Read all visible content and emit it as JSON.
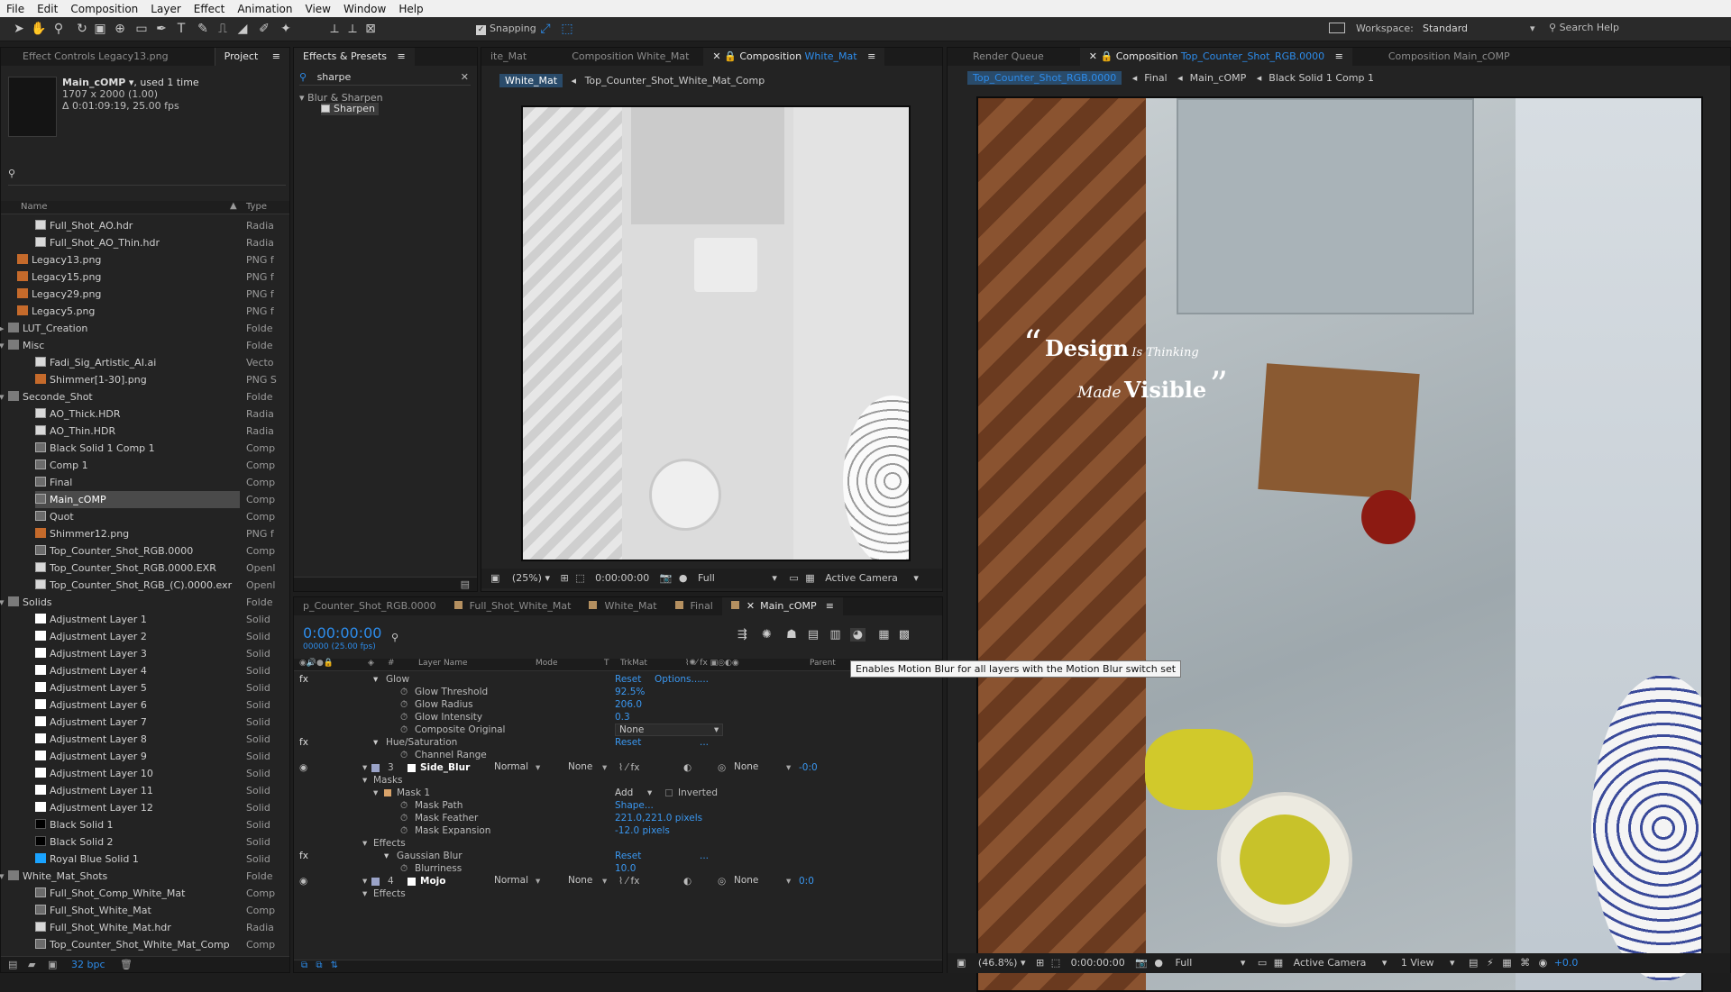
{
  "menu": [
    "File",
    "Edit",
    "Composition",
    "Layer",
    "Effect",
    "Animation",
    "View",
    "Window",
    "Help"
  ],
  "toolbar": {
    "snapping": "Snapping",
    "workspace_label": "Workspace:",
    "workspace_value": "Standard",
    "search_help": "Search Help"
  },
  "left_tabs": {
    "effect_controls": "Effect Controls Legacy13.png",
    "project": "Project"
  },
  "project_info": {
    "name": "Main_cOMP",
    "used": ", used 1 time",
    "size": "1707 x 2000 (1.00)",
    "duration": "Δ 0:01:09:19, 25.00 fps"
  },
  "project_cols": {
    "name": "Name",
    "type": "Type"
  },
  "project_items": [
    {
      "label": "Full_Shot_AO.hdr",
      "type": "Radia"
    },
    {
      "label": "Full_Shot_AO_Thin.hdr",
      "type": "Radia"
    },
    {
      "label": "Legacy13.png",
      "type": "PNG f"
    },
    {
      "label": "Legacy15.png",
      "type": "PNG f"
    },
    {
      "label": "Legacy29.png",
      "type": "PNG f"
    },
    {
      "label": "Legacy5.png",
      "type": "PNG f"
    },
    {
      "label": "LUT_Creation",
      "type": "Folde"
    },
    {
      "label": "Misc",
      "type": "Folde"
    },
    {
      "label": "Fadi_Sig_Artistic_AI.ai",
      "type": "Vecto"
    },
    {
      "label": "Shimmer[1-30].png",
      "type": "PNG S"
    },
    {
      "label": "Seconde_Shot",
      "type": "Folde"
    },
    {
      "label": "AO_Thick.HDR",
      "type": "Radia"
    },
    {
      "label": "AO_Thin.HDR",
      "type": "Radia"
    },
    {
      "label": "Black Solid 1 Comp 1",
      "type": "Comp"
    },
    {
      "label": "Comp 1",
      "type": "Comp"
    },
    {
      "label": "Final",
      "type": "Comp"
    },
    {
      "label": "Main_cOMP",
      "type": "Comp"
    },
    {
      "label": "Quot",
      "type": "Comp"
    },
    {
      "label": "Shimmer12.png",
      "type": "PNG f"
    },
    {
      "label": "Top_Counter_Shot_RGB.0000",
      "type": "Comp"
    },
    {
      "label": "Top_Counter_Shot_RGB.0000.EXR",
      "type": "Openl"
    },
    {
      "label": "Top_Counter_Shot_RGB_(C).0000.exr",
      "type": "Openl"
    },
    {
      "label": "Solids",
      "type": "Folde"
    },
    {
      "label": "Adjustment Layer 1",
      "type": "Solid"
    },
    {
      "label": "Adjustment Layer 2",
      "type": "Solid"
    },
    {
      "label": "Adjustment Layer 3",
      "type": "Solid"
    },
    {
      "label": "Adjustment Layer 4",
      "type": "Solid"
    },
    {
      "label": "Adjustment Layer 5",
      "type": "Solid"
    },
    {
      "label": "Adjustment Layer 6",
      "type": "Solid"
    },
    {
      "label": "Adjustment Layer 7",
      "type": "Solid"
    },
    {
      "label": "Adjustment Layer 8",
      "type": "Solid"
    },
    {
      "label": "Adjustment Layer 9",
      "type": "Solid"
    },
    {
      "label": "Adjustment Layer 10",
      "type": "Solid"
    },
    {
      "label": "Adjustment Layer 11",
      "type": "Solid"
    },
    {
      "label": "Adjustment Layer 12",
      "type": "Solid"
    },
    {
      "label": "Black Solid 1",
      "type": "Solid"
    },
    {
      "label": "Black Solid 2",
      "type": "Solid"
    },
    {
      "label": "Royal Blue Solid 1",
      "type": "Solid"
    },
    {
      "label": "White_Mat_Shots",
      "type": "Folde"
    },
    {
      "label": "Full_Shot_Comp_White_Mat",
      "type": "Comp"
    },
    {
      "label": "Full_Shot_White_Mat",
      "type": "Comp"
    },
    {
      "label": "Full_Shot_White_Mat.hdr",
      "type": "Radia"
    },
    {
      "label": "Top_Counter_Shot_White_Mat_Comp",
      "type": "Comp"
    }
  ],
  "project_footer": {
    "bpc": "32 bpc"
  },
  "effects": {
    "tab": "Effects & Presets",
    "search": "sharpe",
    "category": "Blur & Sharpen",
    "item": "Sharpen"
  },
  "mid_viewer": {
    "tabs": [
      "ite_Mat",
      "Composition White_Mat",
      "Composition"
    ],
    "active_comp": "White_Mat",
    "crumb1": "White_Mat",
    "crumb2": "Top_Counter_Shot_White_Mat_Comp",
    "zoom": "(25%)",
    "time": "0:00:00:00",
    "res": "Full",
    "camera": "Active Camera"
  },
  "right_viewer": {
    "tabs": [
      "Render Queue",
      "Composition",
      "Composition Main_cOMP"
    ],
    "active_comp": "Top_Counter_Shot_RGB.0000",
    "crumbs": [
      "Top_Counter_Shot_RGB.0000",
      "Final",
      "Main_cOMP",
      "Black Solid 1 Comp 1"
    ],
    "quote_design": "Design",
    "quote_is": "Is Thinking",
    "quote_made": "Made",
    "quote_visible": "Visible",
    "zoom": "(46.8%)",
    "time": "0:00:00:00",
    "res": "Full",
    "camera": "Active Camera",
    "views": "1 View",
    "exposure": "+0.0"
  },
  "timeline": {
    "tabs": [
      "p_Counter_Shot_RGB.0000",
      "Full_Shot_White_Mat",
      "White_Mat",
      "Final",
      "Main_cOMP"
    ],
    "timecode": "0:00:00:00",
    "fps": "00000 (25.00 fps)",
    "cols": {
      "num": "#",
      "layer": "Layer Name",
      "mode": "Mode",
      "t": "T",
      "trkmat": "TrkMat",
      "parent": "Parent"
    },
    "tooltip": "Enables Motion Blur for all layers with the Motion Blur switch set",
    "rows": [
      {
        "kind": "fx",
        "label": "Glow",
        "v1": "Reset",
        "v2": "Options...",
        "v3": "..."
      },
      {
        "kind": "prop",
        "label": "Glow Threshold",
        "val": "92.5%"
      },
      {
        "kind": "prop",
        "label": "Glow Radius",
        "val": "206.0"
      },
      {
        "kind": "prop",
        "label": "Glow Intensity",
        "val": "0.3"
      },
      {
        "kind": "propdd",
        "label": "Composite Original",
        "val": "None"
      },
      {
        "kind": "fx",
        "label": "Hue/Saturation",
        "v1": "Reset",
        "v2": "",
        "v3": "..."
      },
      {
        "kind": "prop",
        "label": "Channel Range",
        "val": ""
      },
      {
        "kind": "layer",
        "num": "3",
        "label": "Side_Blur",
        "mode": "Normal",
        "trk": "None",
        "parent": "None",
        "end": "-0:0"
      },
      {
        "kind": "group",
        "label": "Masks",
        "val": ""
      },
      {
        "kind": "mask",
        "label": "Mask 1",
        "val": "Add",
        "extra": "Inverted"
      },
      {
        "kind": "prop",
        "label": "Mask Path",
        "val": "Shape..."
      },
      {
        "kind": "prop",
        "label": "Mask Feather",
        "val": "221.0,221.0 pixels"
      },
      {
        "kind": "prop",
        "label": "Mask Expansion",
        "val": "-12.0 pixels"
      },
      {
        "kind": "group",
        "label": "Effects",
        "val": ""
      },
      {
        "kind": "fx",
        "label": "Gaussian Blur",
        "v1": "Reset",
        "v2": "",
        "v3": "..."
      },
      {
        "kind": "prop",
        "label": "Blurriness",
        "val": "10.0"
      },
      {
        "kind": "layer",
        "num": "4",
        "label": "Mojo",
        "mode": "Normal",
        "trk": "None",
        "parent": "None",
        "end": "0:0"
      },
      {
        "kind": "group",
        "label": "Effects",
        "val": ""
      }
    ]
  },
  "colors": {
    "accent": "#2d8ceb",
    "panel": "#232323",
    "bg": "#1d1d1d"
  }
}
